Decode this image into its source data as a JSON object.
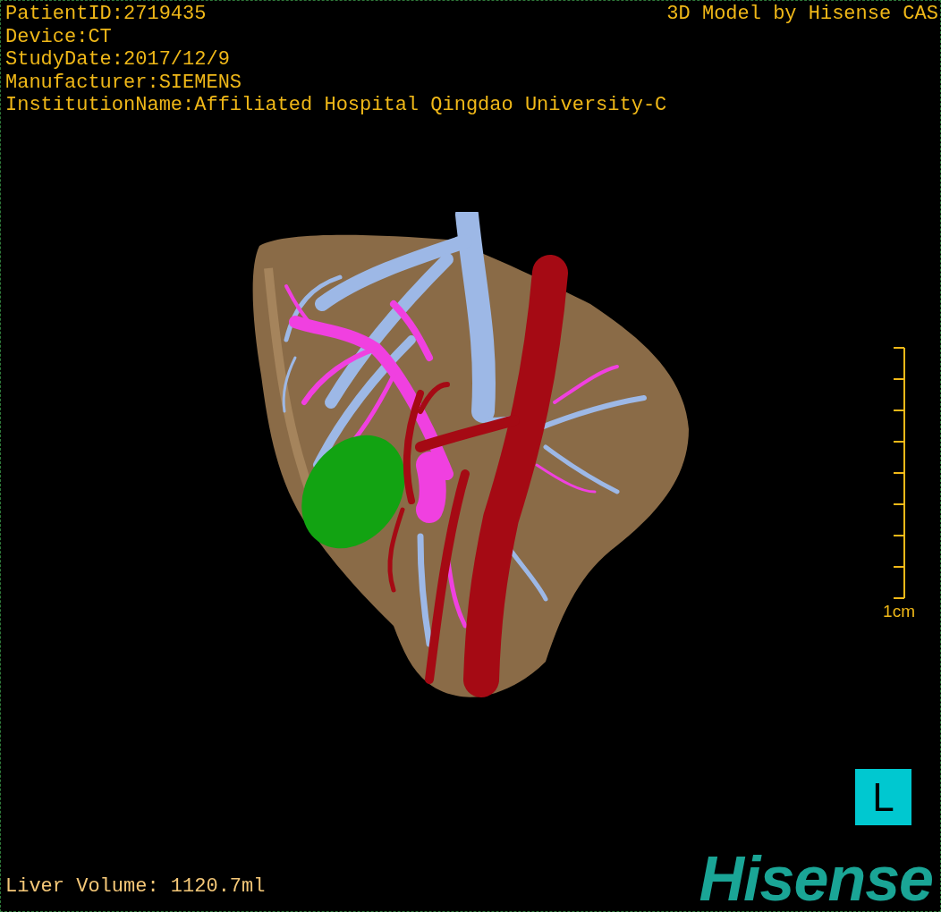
{
  "header_lines": [
    "PatientID:2719435",
    "Device:CT",
    "StudyDate:2017/12/9",
    "Manufacturer:SIEMENS",
    "InstitutionName:Affiliated Hospital Qingdao University-C"
  ],
  "model_credit": "3D Model by Hisense CAS",
  "scale": {
    "label": "1cm"
  },
  "orientation": "L",
  "liver_volume": "Liver Volume: 1120.7ml",
  "logo": "Hisense"
}
